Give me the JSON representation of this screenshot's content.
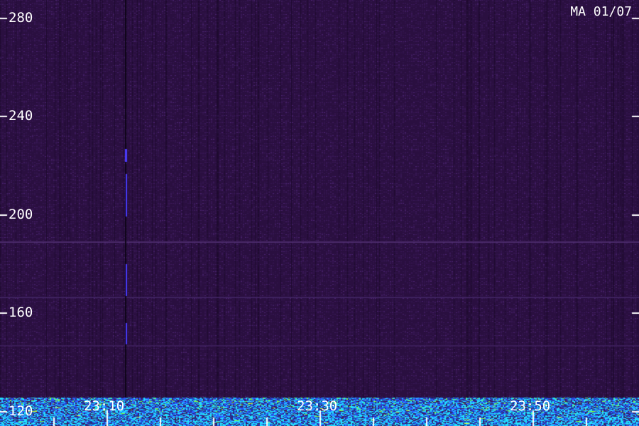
{
  "station_label": "MA 01/07",
  "chart_data": {
    "type": "heatmap",
    "title": "",
    "xlabel": "",
    "ylabel": "",
    "y_ticks": [
      280,
      240,
      200,
      160,
      120
    ],
    "x_ticks": [
      "23:10",
      "23:30",
      "23:50"
    ],
    "ylim": [
      120,
      280
    ],
    "grid": false,
    "colors": {
      "background": "#2a0f40",
      "low": "#3c1a5c",
      "mid": "#2b5cff",
      "high": "#22e0ff",
      "peak": "#7cff4a",
      "tick": "#ffffff"
    }
  }
}
